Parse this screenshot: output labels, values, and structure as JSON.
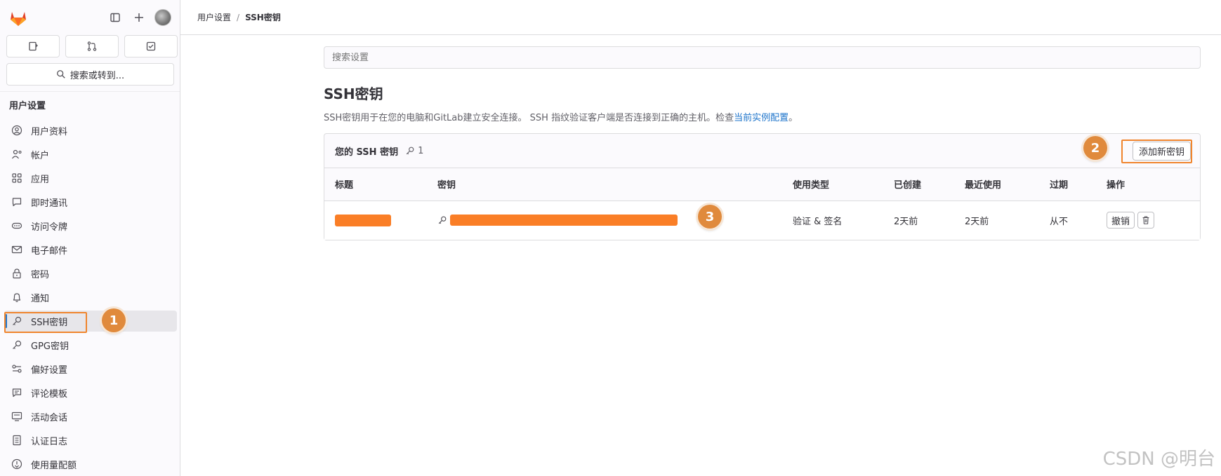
{
  "sidebar": {
    "section_title": "用户设置",
    "search_label": "搜索或转到...",
    "items": [
      {
        "label": "用户资料",
        "icon": "user-circle-icon"
      },
      {
        "label": "帐户",
        "icon": "account-icon"
      },
      {
        "label": "应用",
        "icon": "apps-icon"
      },
      {
        "label": "即时通讯",
        "icon": "chat-icon"
      },
      {
        "label": "访问令牌",
        "icon": "token-icon"
      },
      {
        "label": "电子邮件",
        "icon": "mail-icon"
      },
      {
        "label": "密码",
        "icon": "lock-icon"
      },
      {
        "label": "通知",
        "icon": "bell-icon"
      },
      {
        "label": "SSH密钥",
        "icon": "key-icon"
      },
      {
        "label": "GPG密钥",
        "icon": "key-icon"
      },
      {
        "label": "偏好设置",
        "icon": "preferences-icon"
      },
      {
        "label": "评论模板",
        "icon": "comment-template-icon"
      },
      {
        "label": "活动会话",
        "icon": "monitor-icon"
      },
      {
        "label": "认证日志",
        "icon": "log-icon"
      },
      {
        "label": "使用量配额",
        "icon": "quota-icon"
      }
    ],
    "active_item": "SSH密钥"
  },
  "breadcrumb": {
    "parent": "用户设置",
    "separator": "/",
    "current": "SSH密钥"
  },
  "main": {
    "search_placeholder": "搜索设置",
    "title": "SSH密钥",
    "description": "SSH密钥用于在您的电脑和GitLab建立安全连接。 SSH 指纹验证客户端是否连接到正确的主机。检查",
    "description_link": "当前实例配置",
    "description_end": "。",
    "card": {
      "title": "您的 SSH 密钥",
      "key_count": "1",
      "add_button": "添加新密钥",
      "columns": [
        "标题",
        "密钥",
        "使用类型",
        "已创建",
        "最近使用",
        "过期",
        "操作"
      ],
      "rows": [
        {
          "usage": "验证 & 签名",
          "created": "2天前",
          "last_used": "2天前",
          "expires": "从不",
          "revoke": "撤销"
        }
      ]
    }
  },
  "annotations": {
    "step1": "1",
    "step2": "2",
    "step3": "3",
    "highlight_color": "#f0852d"
  },
  "watermark": "CSDN @明台",
  "colors": {
    "accent_link": "#1f75cb",
    "redaction": "#fa7e26",
    "badge": "#e08a3c"
  }
}
